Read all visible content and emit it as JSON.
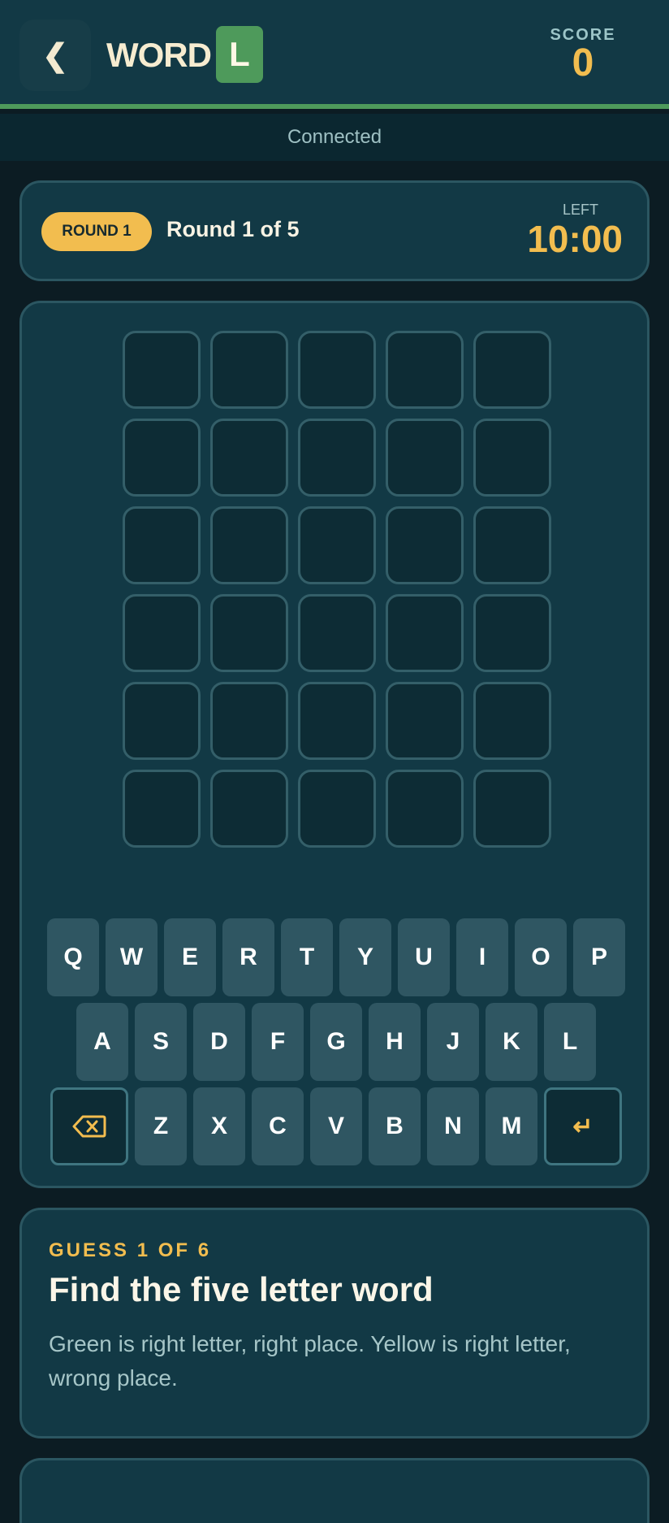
{
  "header": {
    "back_icon": "chevron-left-icon",
    "back_symbol": "❮",
    "logo_text": "WORD",
    "logo_tile_letter": "L",
    "score_label": "SCORE",
    "score_value": "0"
  },
  "status": {
    "text": "Connected"
  },
  "round": {
    "pill_label": "ROUND 1",
    "text": "Round 1 of 5",
    "left_label": "LEFT",
    "timer": "10:00"
  },
  "board": {
    "rows": 6,
    "cols": 5,
    "letters": [
      [
        "",
        "",
        "",
        "",
        ""
      ],
      [
        "",
        "",
        "",
        "",
        ""
      ],
      [
        "",
        "",
        "",
        "",
        ""
      ],
      [
        "",
        "",
        "",
        "",
        ""
      ],
      [
        "",
        "",
        "",
        "",
        ""
      ],
      [
        "",
        "",
        "",
        "",
        ""
      ]
    ]
  },
  "keyboard": {
    "row1": [
      "Q",
      "W",
      "E",
      "R",
      "T",
      "Y",
      "U",
      "I",
      "O",
      "P"
    ],
    "row2": [
      "A",
      "S",
      "D",
      "F",
      "G",
      "H",
      "J",
      "K",
      "L"
    ],
    "row3": [
      "Z",
      "X",
      "C",
      "V",
      "B",
      "N",
      "M"
    ],
    "backspace_icon": "backspace-icon",
    "enter_icon": "enter-icon",
    "enter_symbol": "↵"
  },
  "info": {
    "guess_label": "GUESS 1 OF 6",
    "title": "Find the five letter word",
    "description": "Green is right letter, right place. Yellow is right letter, wrong place."
  },
  "colors": {
    "accent_green": "#4e9a5b",
    "accent_yellow": "#f2bd4f",
    "panel": "#123945",
    "background": "#0c1c23"
  }
}
